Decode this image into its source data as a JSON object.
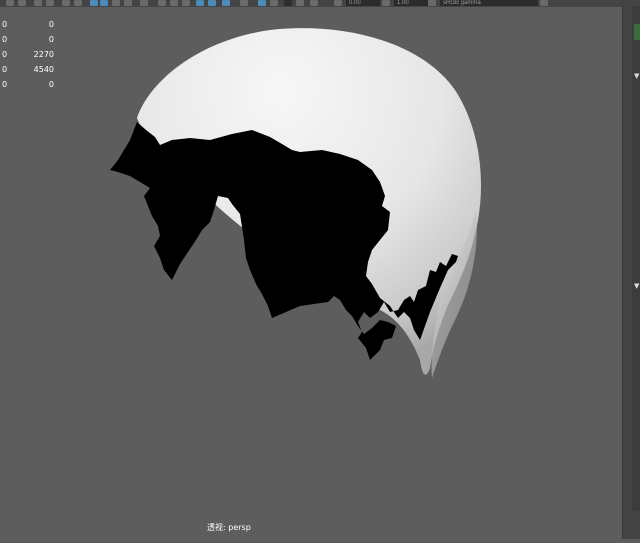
{
  "toolbar": {
    "field_1": "0.00",
    "field_2": "1.00",
    "field_3": "sRGB gamma"
  },
  "hud": {
    "rows": [
      {
        "a": "0",
        "b": "0"
      },
      {
        "a": "0",
        "b": "0"
      },
      {
        "a": "0",
        "b": "2270"
      },
      {
        "a": "0",
        "b": "4540"
      },
      {
        "a": "0",
        "b": "0"
      }
    ]
  },
  "viewport": {
    "camera_label": "透视: persp",
    "background_color": "#5d5d5d",
    "object": "head-mesh"
  }
}
